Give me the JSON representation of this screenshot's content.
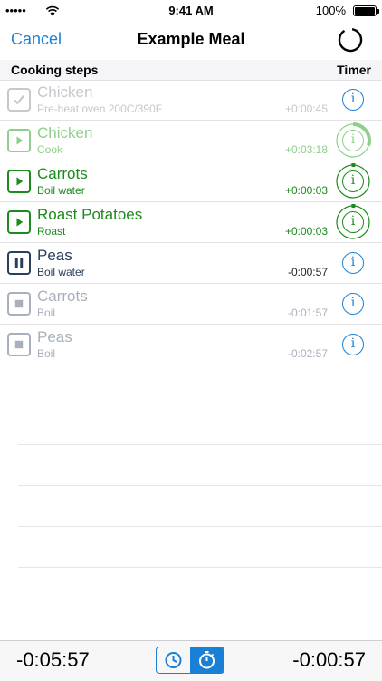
{
  "status_bar": {
    "carrier": "•••••",
    "time": "9:41 AM",
    "battery": "100%"
  },
  "nav": {
    "cancel": "Cancel",
    "title": "Example Meal"
  },
  "header": {
    "steps": "Cooking steps",
    "timer": "Timer"
  },
  "steps": [
    {
      "item": "Chicken",
      "action": "Pre-heat oven 200C/390F",
      "time": "+0:00:45",
      "state": "done"
    },
    {
      "item": "Chicken",
      "action": "Cook",
      "time": "+0:03:18",
      "state": "playing-light",
      "timer_ring": 0.3
    },
    {
      "item": "Carrots",
      "action": "Boil water",
      "time": "+0:00:03",
      "state": "playing",
      "timer_ring": 0.03
    },
    {
      "item": "Roast Potatoes",
      "action": "Roast",
      "time": "+0:00:03",
      "state": "playing",
      "timer_ring": 0.03
    },
    {
      "item": "Peas",
      "action": "Boil water",
      "time": "-0:00:57",
      "state": "paused"
    },
    {
      "item": "Carrots",
      "action": "Boil",
      "time": "-0:01:57",
      "state": "stopped"
    },
    {
      "item": "Peas",
      "action": "Boil",
      "time": "-0:02:57",
      "state": "stopped"
    }
  ],
  "toolbar": {
    "left_time": "-0:05:57",
    "right_time": "-0:00:57",
    "mode_options": [
      "clock-icon",
      "stopwatch-icon"
    ],
    "selected_mode": "stopwatch-icon"
  },
  "colors": {
    "accent": "#1a7fd6",
    "active_green": "#1c8a1c",
    "light_green": "#8fcf8b",
    "paused_navy": "#2b3f5c",
    "stopped_gray": "#a9b0bd",
    "done_gray": "#c7c7cc"
  }
}
